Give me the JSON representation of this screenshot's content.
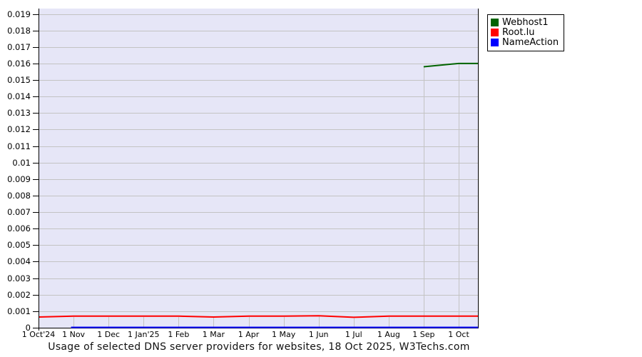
{
  "chart_data": {
    "type": "line",
    "title": "Usage of selected DNS server providers for websites, 18 Oct 2025, W3Techs.com",
    "x_tick_labels": [
      "1 Oct'24",
      "1 Nov",
      "1 Dec",
      "1 Jan'25",
      "1 Feb",
      "1 Mar",
      "1 Apr",
      "1 May",
      "1 Jun",
      "1 Jul",
      "1 Aug",
      "1 Sep",
      "1 Oct"
    ],
    "y_tick_labels": [
      "0",
      "0.001",
      "0.002",
      "0.003",
      "0.004",
      "0.005",
      "0.006",
      "0.007",
      "0.008",
      "0.009",
      "0.01",
      "0.011",
      "0.012",
      "0.013",
      "0.014",
      "0.015",
      "0.016",
      "0.017",
      "0.018",
      "0.019"
    ],
    "ylim": [
      0,
      0.019325
    ],
    "x_start_month": 0,
    "x_end_month": 12.57,
    "grid": true,
    "legend_position": "top-right",
    "colors": {
      "plot_bg": "#e6e6f7",
      "grid": "#c3c3c3",
      "axis": "#000000",
      "webhost1": "#006400",
      "root_lu": "#ff0000",
      "nameaction": "#0000ff"
    },
    "series": [
      {
        "name": "Webhost1",
        "color": "#006400",
        "points": [
          [
            11,
            0.0158
          ],
          [
            12,
            0.016
          ],
          [
            12.57,
            0.016
          ]
        ]
      },
      {
        "name": "Root.lu",
        "color": "#ff0000",
        "points": [
          [
            0,
            0.00065
          ],
          [
            1,
            0.0007
          ],
          [
            2,
            0.0007
          ],
          [
            3,
            0.0007
          ],
          [
            4,
            0.0007
          ],
          [
            5,
            0.00065
          ],
          [
            6,
            0.0007
          ],
          [
            7,
            0.0007
          ],
          [
            8,
            0.00072
          ],
          [
            9,
            0.00063
          ],
          [
            10,
            0.0007
          ],
          [
            11,
            0.0007
          ],
          [
            12,
            0.0007
          ],
          [
            12.57,
            0.0007
          ]
        ]
      },
      {
        "name": "NameAction",
        "color": "#0000ff",
        "points": [
          [
            0.93,
            2e-05
          ],
          [
            12.57,
            2e-05
          ]
        ]
      }
    ]
  }
}
